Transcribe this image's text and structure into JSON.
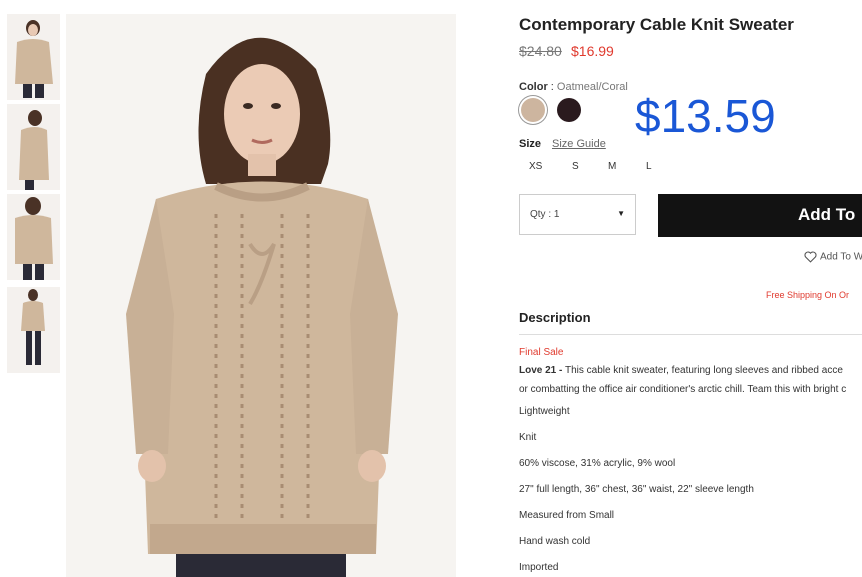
{
  "product": {
    "title": "Contemporary Cable Knit Sweater",
    "original_price": "$24.80",
    "sale_price": "$16.99",
    "overlay_price": "$13.59",
    "color_label": "Color",
    "color_separator": " : ",
    "color_value": "Oatmeal/Coral",
    "swatches": [
      {
        "name": "Oatmeal/Coral",
        "hex": "#cdb59f",
        "selected": true
      },
      {
        "name": "Black",
        "hex": "#2a1a1e",
        "selected": false
      }
    ],
    "size_label": "Size",
    "size_guide": "Size Guide",
    "sizes": [
      "XS",
      "S",
      "M",
      "L"
    ],
    "qty_label": "Qty : 1",
    "add_button": "Add To",
    "wishlist": "Add To W",
    "shipping": "Free Shipping On Or"
  },
  "description": {
    "heading": "Description",
    "final_sale": "Final Sale",
    "brand": "Love 21 -",
    "intro_1": " This cable knit sweater, featuring long sleeves and ribbed acce",
    "intro_2": "or combatting the office air conditioner's arctic chill. Team this with bright c",
    "details": [
      "Lightweight",
      "Knit",
      "60% viscose, 31% acrylic, 9% wool",
      "27\" full length, 36\" chest, 36\" waist, 22\" sleeve length",
      "Measured from Small",
      "Hand wash cold",
      "Imported"
    ]
  },
  "colors": {
    "sale_red": "#e03a2e",
    "overlay_blue": "#1a57d6",
    "button_black": "#121212",
    "sweater": "#cfb79c"
  }
}
